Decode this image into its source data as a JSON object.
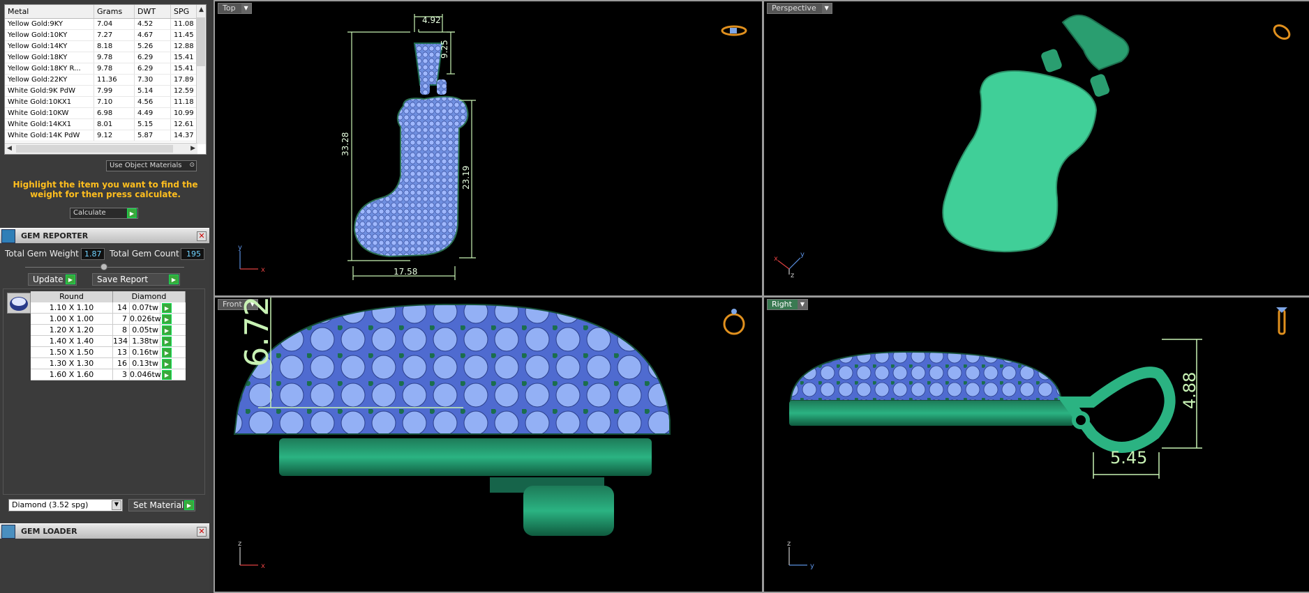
{
  "metal_table": {
    "headers": [
      "Metal",
      "Grams",
      "DWT",
      "SPG"
    ],
    "rows": [
      [
        "Yellow Gold:9KY",
        "7.04",
        "4.52",
        "11.08"
      ],
      [
        "Yellow Gold:10KY",
        "7.27",
        "4.67",
        "11.45"
      ],
      [
        "Yellow Gold:14KY",
        "8.18",
        "5.26",
        "12.88"
      ],
      [
        "Yellow Gold:18KY",
        "9.78",
        "6.29",
        "15.41"
      ],
      [
        "Yellow Gold:18KY R...",
        "9.78",
        "6.29",
        "15.41"
      ],
      [
        "Yellow Gold:22KY",
        "11.36",
        "7.30",
        "17.89"
      ],
      [
        "White Gold:9K PdW",
        "7.99",
        "5.14",
        "12.59"
      ],
      [
        "White Gold:10KX1",
        "7.10",
        "4.56",
        "11.18"
      ],
      [
        "White Gold:10KW",
        "6.98",
        "4.49",
        "10.99"
      ],
      [
        "White Gold:14KX1",
        "8.01",
        "5.15",
        "12.61"
      ],
      [
        "White Gold:14K PdW",
        "9.12",
        "5.87",
        "14.37"
      ]
    ]
  },
  "use_object_materials": "Use Object Materials",
  "hint": "Highlight the item you want to find the weight for then press calculate.",
  "calculate_label": "Calculate",
  "gem_reporter": {
    "title": "GEM REPORTER",
    "total_weight_label": "Total Gem Weight",
    "total_weight": "1.87",
    "total_count_label": "Total Gem Count",
    "total_count": "195",
    "update_label": "Update",
    "save_report_label": "Save Report",
    "headers": [
      "Round",
      "Diamond"
    ],
    "rows": [
      [
        "1.10 X 1.10",
        "14",
        "0.07tw"
      ],
      [
        "1.00 X 1.00",
        "7",
        "0.026tw"
      ],
      [
        "1.20 X 1.20",
        "8",
        "0.05tw"
      ],
      [
        "1.40 X 1.40",
        "134",
        "1.38tw"
      ],
      [
        "1.50 X 1.50",
        "13",
        "0.16tw"
      ],
      [
        "1.30 X 1.30",
        "16",
        "0.13tw"
      ],
      [
        "1.60 X 1.60",
        "3",
        "0.046tw"
      ]
    ],
    "material_select": "Diamond    (3.52 spg)",
    "set_material_label": "Set Material"
  },
  "gem_loader": {
    "title": "GEM LOADER"
  },
  "viewports": {
    "top": {
      "label": "Top",
      "dims": [
        "4.92",
        "9.25",
        "33.28",
        "23.19",
        "17.58"
      ],
      "axes": [
        "y",
        "x"
      ]
    },
    "perspective": {
      "label": "Perspective",
      "axes": [
        "x",
        "y",
        "z"
      ]
    },
    "front": {
      "label": "Front",
      "dims": [
        "6.72"
      ],
      "axes": [
        "z",
        "x"
      ]
    },
    "right": {
      "label": "Right",
      "dims": [
        "4.88",
        "5.45"
      ],
      "axes": [
        "z",
        "y"
      ]
    }
  },
  "colors": {
    "metal": "#2fb07e",
    "gem": "#8fb0ff",
    "dimension": "#b9f5a8",
    "highlight_text": "#ffbe1e"
  }
}
